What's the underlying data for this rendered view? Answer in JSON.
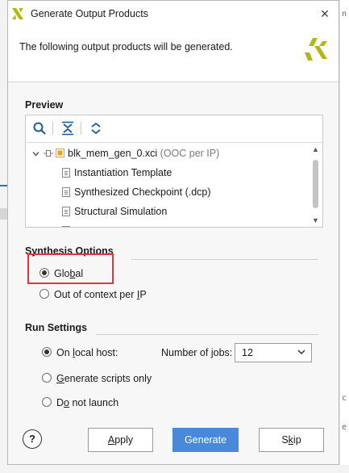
{
  "dialog": {
    "title": "Generate Output Products",
    "header_text": "The following output products will be generated."
  },
  "preview": {
    "section_title": "Preview",
    "toolbar_icons": [
      "search-icon",
      "collapse-all-icon",
      "expand-all-icon"
    ],
    "tree": {
      "root": {
        "name": "blk_mem_gen_0.xci",
        "suffix": "(OOC per IP)"
      },
      "children": [
        "Instantiation Template",
        "Synthesized Checkpoint (.dcp)",
        "Structural Simulation"
      ]
    }
  },
  "synthesis": {
    "section_title": "Synthesis Options",
    "options": [
      {
        "pre": "Glo",
        "u": "b",
        "post": "al",
        "selected": true
      },
      {
        "pre": "Out of context per ",
        "u": "I",
        "post": "P",
        "selected": false
      }
    ]
  },
  "run": {
    "section_title": "Run Settings",
    "options": [
      {
        "pre": "On ",
        "u": "l",
        "post": "ocal host:",
        "selected": true
      },
      {
        "pre": "",
        "u": "G",
        "post": "enerate scripts only",
        "selected": false
      },
      {
        "pre": "D",
        "u": "o",
        "post": " not launch",
        "selected": false
      }
    ],
    "jobs_label_pre": "Number of ",
    "jobs_label_u": "j",
    "jobs_label_post": "obs:",
    "jobs_value": "12"
  },
  "footer": {
    "help_label": "?",
    "apply": {
      "pre": "",
      "u": "A",
      "post": "pply"
    },
    "generate": {
      "label": "Generate"
    },
    "skip": {
      "pre": "S",
      "u": "k",
      "post": "ip"
    }
  },
  "colors": {
    "accent": "#4a88d9",
    "highlight_box": "#e0383e",
    "xilinx_logo": "#b3b619",
    "ip_icon": "#e8a22a"
  }
}
